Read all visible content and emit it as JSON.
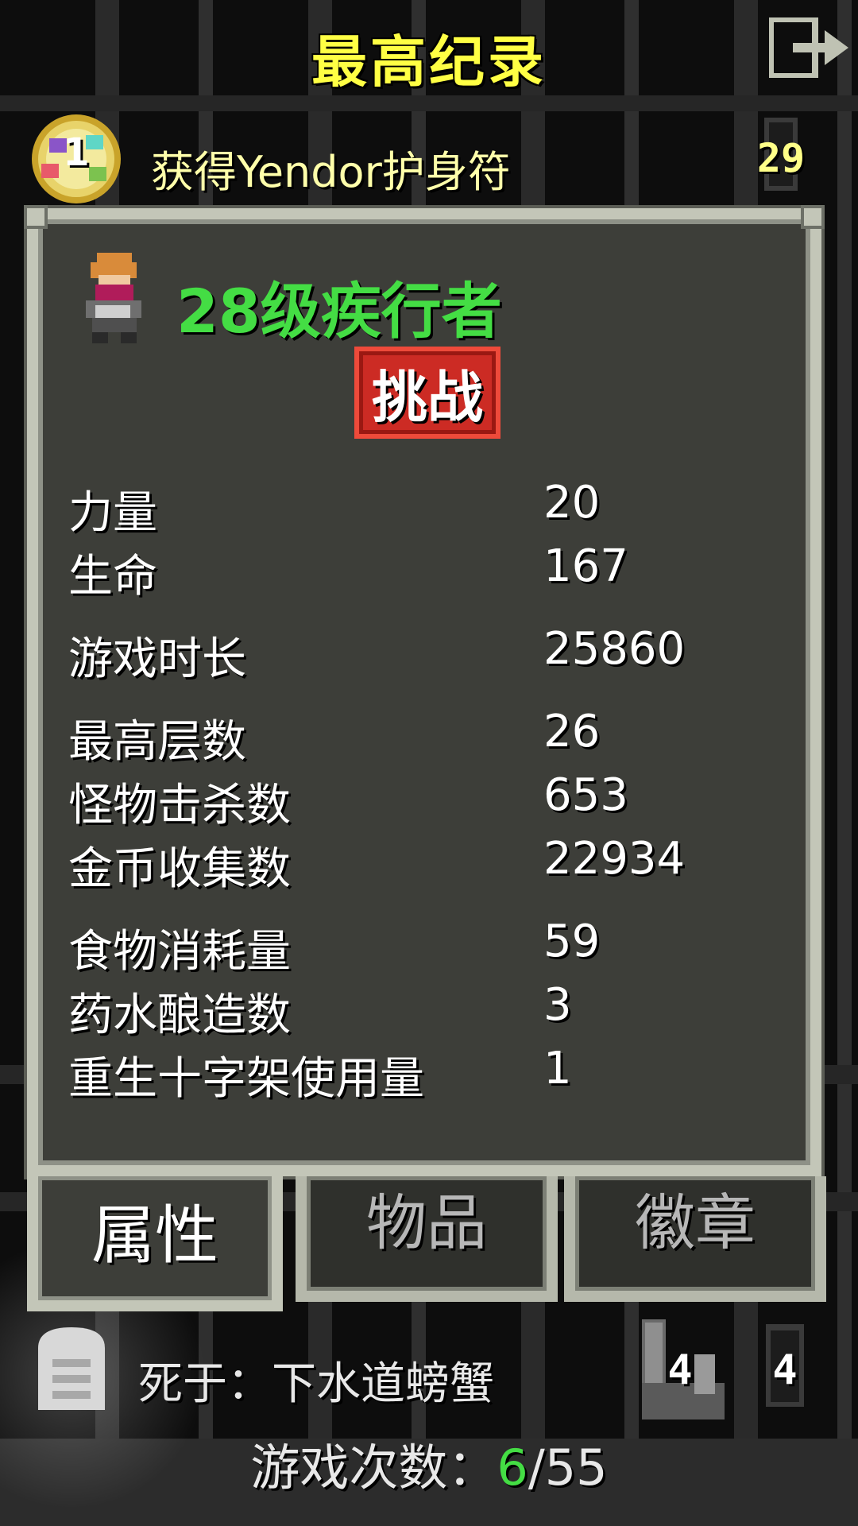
{
  "header": {
    "title": "最高纪录"
  },
  "achievement": {
    "rank": "1",
    "text": "获得Yendor护身符",
    "depth": "29"
  },
  "hero": {
    "title": "28级疾行者",
    "challenge_label": "挑战"
  },
  "stats": [
    {
      "label": "力量",
      "value": "20"
    },
    {
      "label": "生命",
      "value": "167"
    },
    {
      "label": "游戏时长",
      "value": "25860"
    },
    {
      "label": "最高层数",
      "value": "26"
    },
    {
      "label": "怪物击杀数",
      "value": "653"
    },
    {
      "label": "金币收集数",
      "value": "22934"
    },
    {
      "label": "食物消耗量",
      "value": "59"
    },
    {
      "label": "药水酿造数",
      "value": "3"
    },
    {
      "label": "重生十字架使用量",
      "value": "1"
    }
  ],
  "tabs": [
    {
      "label": "属性",
      "active": true
    },
    {
      "label": "物品",
      "active": false
    },
    {
      "label": "徽章",
      "active": false
    }
  ],
  "footer": {
    "death": "死于：下水道螃蟹",
    "badge_count_1": "4",
    "badge_count_2": "4",
    "games_label": "游戏次数：",
    "games_current": "6",
    "games_total": "/55"
  },
  "colors": {
    "title": "#ffff44",
    "hero_title": "#44dd44",
    "challenge": "#cc2b24",
    "panel": "#3d3e39",
    "border": "#c3c6b8"
  },
  "icons": {
    "exit": "exit-icon",
    "amulet": "yendor-amulet-icon",
    "depth": "depth-icon",
    "tomb": "tombstone-icon"
  }
}
